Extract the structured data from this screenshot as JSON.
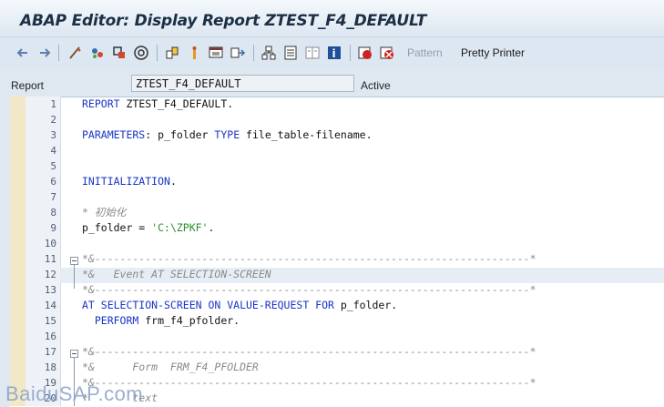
{
  "window": {
    "title": "ABAP Editor: Display Report ZTEST_F4_DEFAULT"
  },
  "toolbar": {
    "icons": [
      "back-icon",
      "forward-icon",
      "other-object-icon",
      "check-icon",
      "activate-icon",
      "test-icon",
      "where-used-icon",
      "enhance-icon",
      "navigation-window-icon",
      "insert-statement-icon",
      "display-object-list-icon",
      "help-icon",
      "set-breakpoint-icon",
      "remove-breakpoint-icon"
    ],
    "pattern_label": "Pattern",
    "pretty_printer_label": "Pretty Printer"
  },
  "report": {
    "label": "Report",
    "name": "ZTEST_F4_DEFAULT",
    "status": "Active"
  },
  "editor": {
    "lines": [
      {
        "n": "1",
        "segments": [
          {
            "t": "REPORT",
            "c": "kw"
          },
          {
            "t": " ZTEST_F4_DEFAULT.",
            "c": ""
          }
        ]
      },
      {
        "n": "2",
        "segments": []
      },
      {
        "n": "3",
        "segments": [
          {
            "t": "PARAMETERS",
            "c": "kw"
          },
          {
            "t": ": p_folder ",
            "c": ""
          },
          {
            "t": "TYPE",
            "c": "kw"
          },
          {
            "t": " file_table-filename.",
            "c": ""
          }
        ]
      },
      {
        "n": "4",
        "segments": []
      },
      {
        "n": "5",
        "segments": []
      },
      {
        "n": "6",
        "segments": [
          {
            "t": "INITIALIZATION",
            "c": "kw"
          },
          {
            "t": ".",
            "c": ""
          }
        ]
      },
      {
        "n": "7",
        "segments": []
      },
      {
        "n": "8",
        "segments": [
          {
            "t": "* 初始化",
            "c": "cm"
          }
        ]
      },
      {
        "n": "9",
        "segments": [
          {
            "t": "p_folder = ",
            "c": ""
          },
          {
            "t": "'C:\\ZPKF'",
            "c": "str"
          },
          {
            "t": ".",
            "c": ""
          }
        ]
      },
      {
        "n": "10",
        "segments": []
      },
      {
        "n": "11",
        "segments": [
          {
            "t": "*&---------------------------------------------------------------------*",
            "c": "cm"
          }
        ]
      },
      {
        "n": "12",
        "segments": [
          {
            "t": "*&   Event AT SELECTION-SCREEN",
            "c": "cm"
          }
        ]
      },
      {
        "n": "13",
        "segments": [
          {
            "t": "*&---------------------------------------------------------------------*",
            "c": "cm"
          }
        ]
      },
      {
        "n": "14",
        "segments": [
          {
            "t": "AT SELECTION-SCREEN ON VALUE-REQUEST FOR",
            "c": "kw"
          },
          {
            "t": " p_folder.",
            "c": ""
          }
        ]
      },
      {
        "n": "15",
        "segments": [
          {
            "t": "  PERFORM",
            "c": "kw"
          },
          {
            "t": " frm_f4_pfolder.",
            "c": ""
          }
        ]
      },
      {
        "n": "16",
        "segments": []
      },
      {
        "n": "17",
        "segments": [
          {
            "t": "*&---------------------------------------------------------------------*",
            "c": "cm"
          }
        ]
      },
      {
        "n": "18",
        "segments": [
          {
            "t": "*&      Form  FRM_F4_PFOLDER",
            "c": "cm"
          }
        ]
      },
      {
        "n": "19",
        "segments": [
          {
            "t": "*&---------------------------------------------------------------------*",
            "c": "cm"
          }
        ]
      },
      {
        "n": "20",
        "segments": [
          {
            "t": "*       text",
            "c": "cm"
          }
        ]
      }
    ]
  },
  "watermark": "BaiduSAP.com"
}
